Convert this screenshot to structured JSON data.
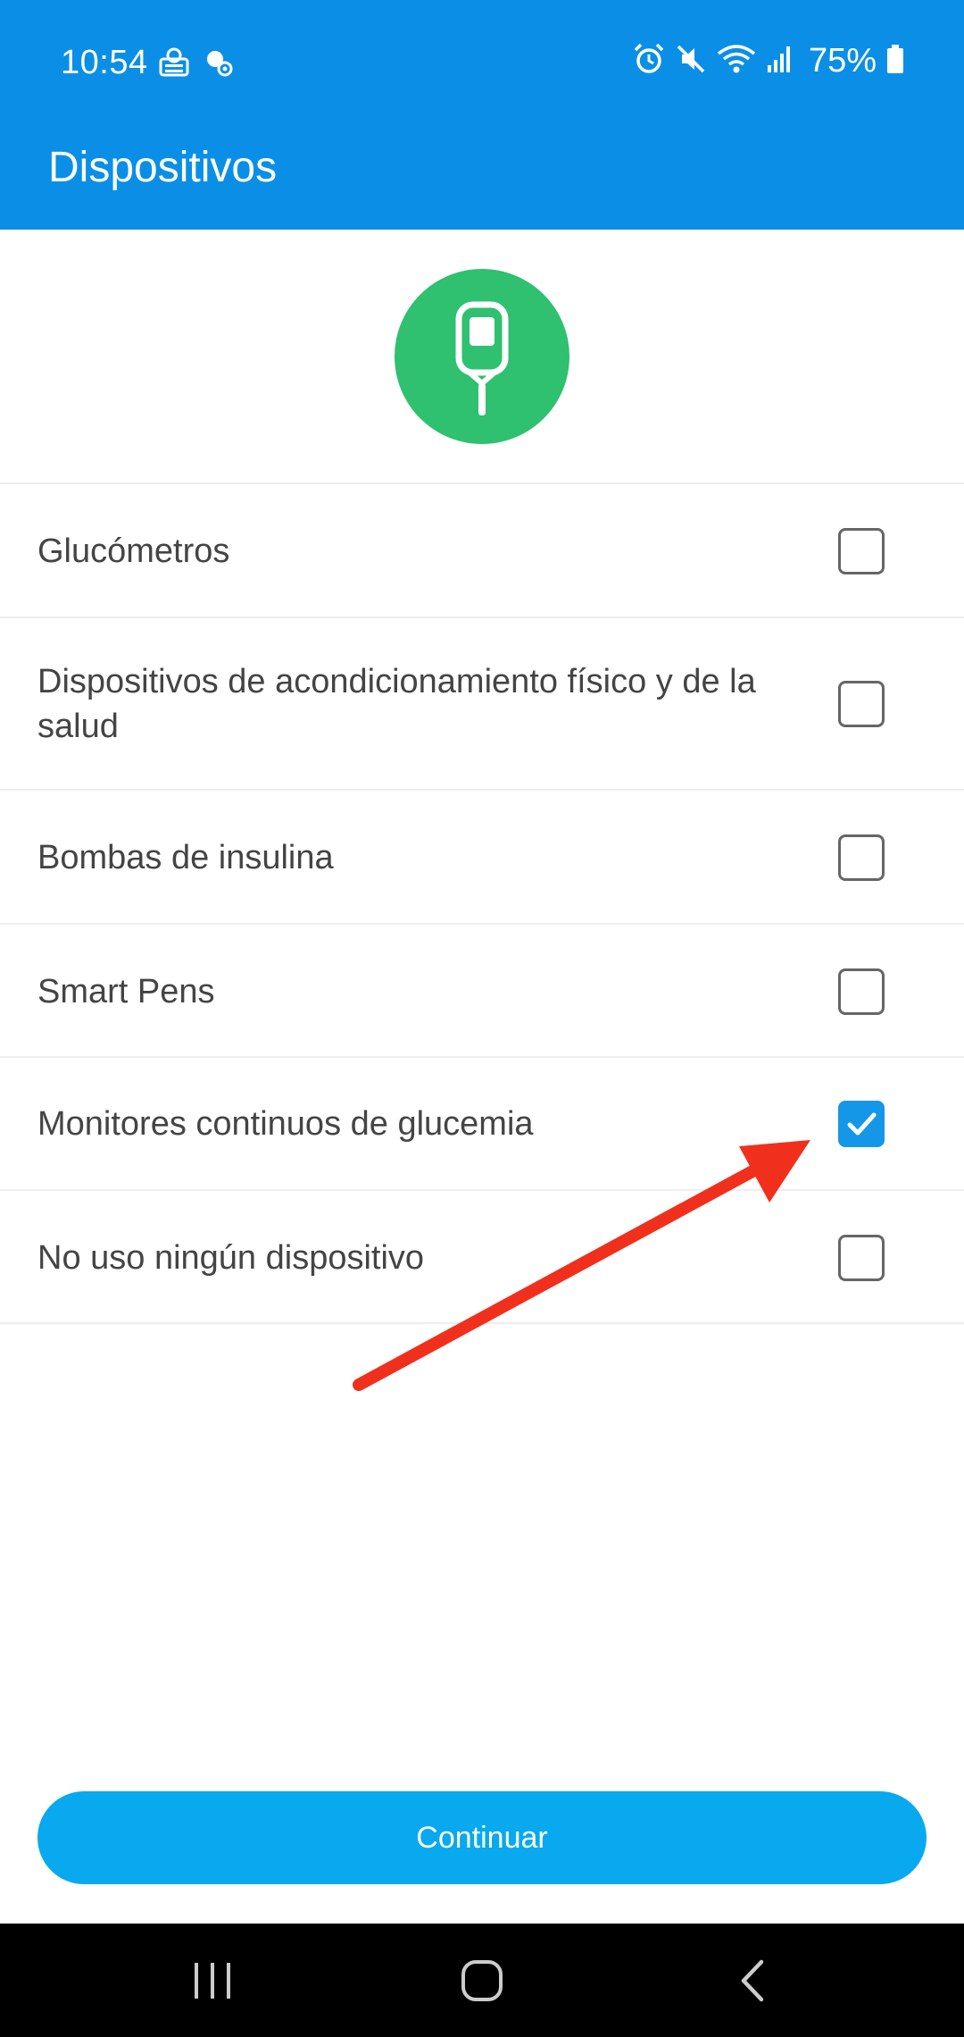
{
  "status_bar": {
    "time": "10:54",
    "battery": "75%",
    "icons_left": [
      "notification-app-icon",
      "settings-gear-icon"
    ],
    "icons_right": [
      "alarm-icon",
      "mute-icon",
      "wifi-icon",
      "signal-icon",
      "battery-icon"
    ]
  },
  "app_bar": {
    "title": "Dispositivos"
  },
  "hero": {
    "icon": "glucometer-icon",
    "color": "#2fc070"
  },
  "devices": [
    {
      "label": "Glucómetros",
      "checked": false
    },
    {
      "label": "Dispositivos de acondicionamiento físico y de la salud",
      "checked": false
    },
    {
      "label": "Bombas de insulina",
      "checked": false
    },
    {
      "label": "Smart Pens",
      "checked": false
    },
    {
      "label": "Monitores continuos de glucemia",
      "checked": true
    },
    {
      "label": "No uso ningún dispositivo",
      "checked": false
    }
  ],
  "continue_button": {
    "label": "Continuar"
  },
  "colors": {
    "header": "#0b8fe6",
    "accent": "#1597e8",
    "button": "#08a9ee",
    "annotation": "#f0301c"
  }
}
